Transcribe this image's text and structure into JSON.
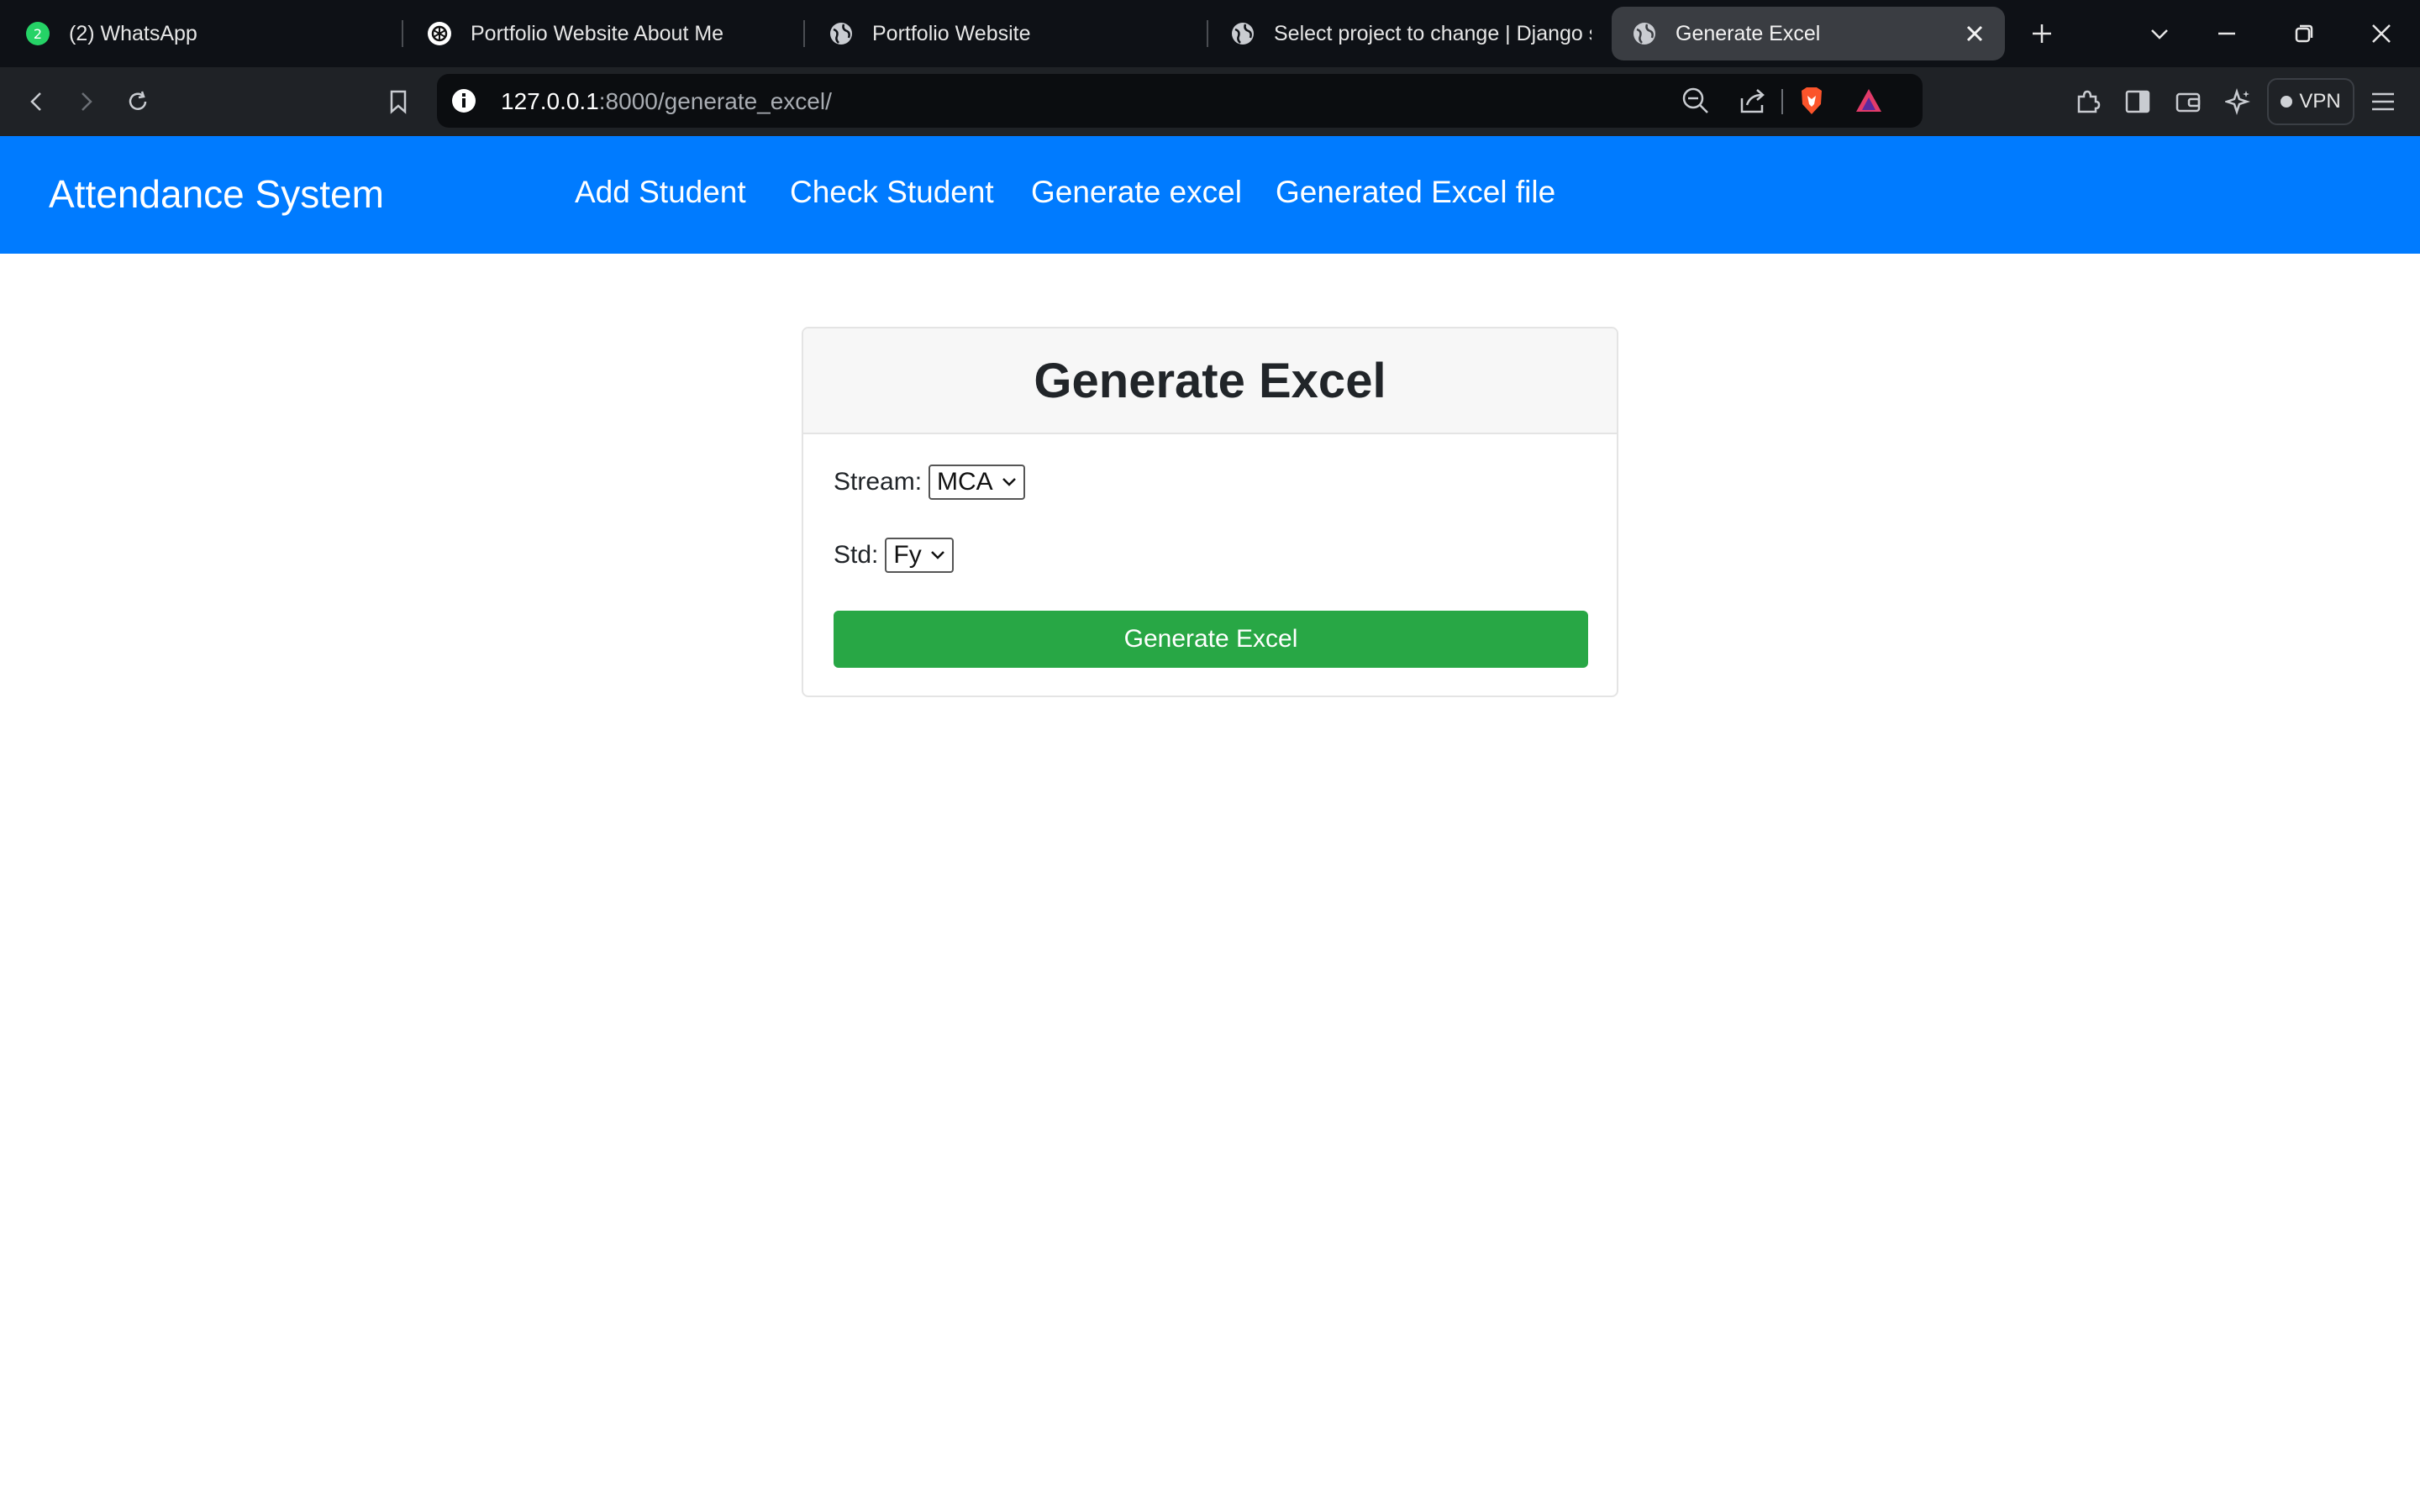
{
  "browser": {
    "tabs": [
      {
        "title": "(2) WhatsApp",
        "badge": "2",
        "icon": "whatsapp-icon"
      },
      {
        "title": "Portfolio Website About Me",
        "icon": "openai-icon"
      },
      {
        "title": "Portfolio Website",
        "icon": "globe-icon"
      },
      {
        "title": "Select project to change | Django si",
        "icon": "globe-icon"
      },
      {
        "title": "Generate Excel",
        "icon": "globe-icon",
        "active": true
      }
    ],
    "url_host": "127.0.0.1",
    "url_path": ":8000/generate_excel/",
    "vpn_label": "VPN"
  },
  "navbar": {
    "brand": "Attendance System",
    "links": [
      "Add Student",
      "Check Student",
      "Generate excel",
      "Generated Excel file"
    ],
    "color": "#007bff"
  },
  "form": {
    "title": "Generate Excel",
    "stream_label": "Stream:",
    "stream_value": "MCA",
    "std_label": "Std:",
    "std_value": "Fy",
    "submit_label": "Generate Excel",
    "submit_color": "#28a745"
  }
}
